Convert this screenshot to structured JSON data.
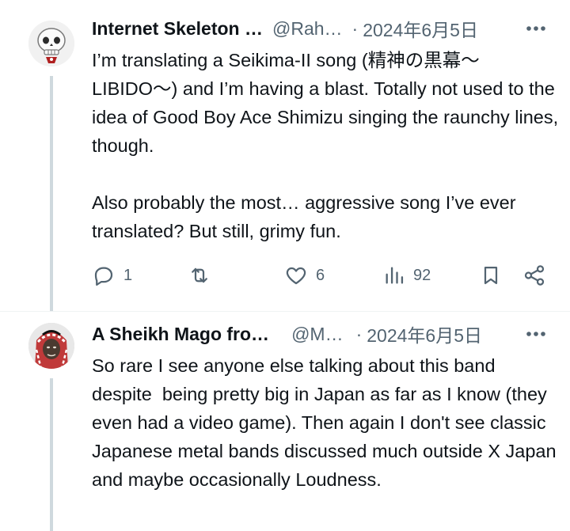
{
  "tweets": [
    {
      "author_name": "Internet Skeleton …",
      "handle": "@Rah…",
      "separator": "·",
      "date": "2024年6月5日",
      "text": "I’m translating a Seikima-II song (精神の黒幕〜LIBIDO〜) and I’m having a blast. Totally not used to the idea of Good Boy Ace Shimizu singing the raunchy lines, though.\n\nAlso probably the most… aggressive song I’ve ever translated? But still, grimy fun.",
      "actions": {
        "replies": "1",
        "retweets": "",
        "likes": "6",
        "views": "92"
      }
    },
    {
      "author_name": "A Sheikh Mago fro…",
      "handle": "@M…",
      "separator": "·",
      "date": "2024年6月5日",
      "text": "So rare I see anyone else talking about this band despite  being pretty big in Japan as far as I know (they even had a video game). Then again I don't see classic Japanese metal bands discussed much outside X Japan and maybe occasionally Loudness."
    }
  ],
  "icons": {
    "reply": "speech-bubble-icon",
    "retweet": "retweet-arrows-icon",
    "like": "heart-icon",
    "views": "bar-chart-icon",
    "bookmark": "bookmark-icon",
    "share": "share-icon",
    "more": "more-dots-icon"
  },
  "colors": {
    "text": "#0f1419",
    "secondary": "#536471",
    "thread_line": "#cfd9de"
  }
}
